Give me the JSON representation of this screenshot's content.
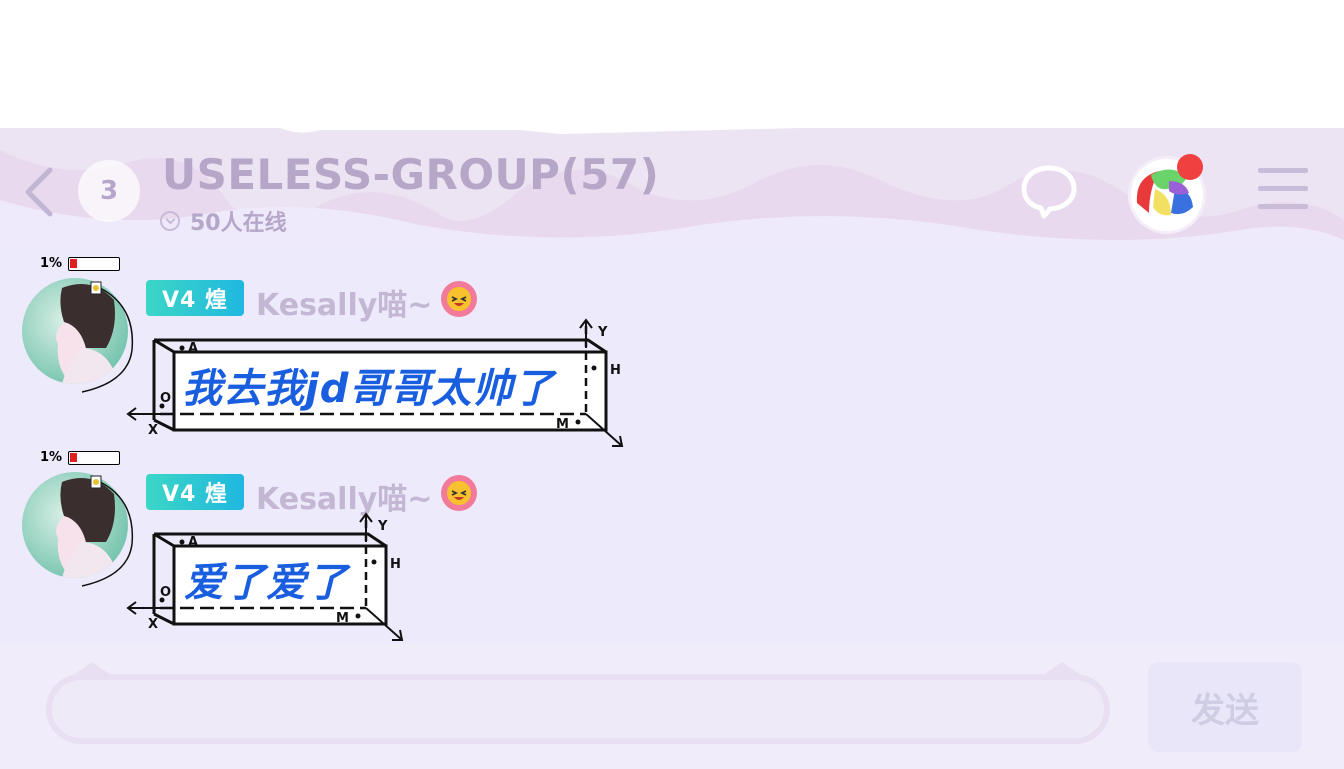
{
  "header": {
    "unread_count": "3",
    "group_title": "USELESS-GROUP(57)",
    "online_text": "50人在线",
    "icons": {
      "back": "chevron-left-icon",
      "online": "chevron-down-circle-icon",
      "chat": "speech-bubble-icon",
      "menu": "hamburger-menu-icon"
    }
  },
  "messages": [
    {
      "battery_pct": "1%",
      "level_badge": "V4 煌",
      "nickname": "Kesally喵~",
      "text": "我去我jd哥哥太帅了",
      "axis_labels": [
        "A",
        "O",
        "X",
        "Y",
        "H",
        "M"
      ]
    },
    {
      "battery_pct": "1%",
      "level_badge": "V4 煌",
      "nickname": "Kesally喵~",
      "text": "爱了爱了",
      "axis_labels": [
        "A",
        "O",
        "X",
        "Y",
        "H",
        "M"
      ]
    }
  ],
  "input": {
    "value": "",
    "placeholder": "",
    "send_label": "发送"
  },
  "colors": {
    "title": "#b6a7c9",
    "chat_bg": "#edeafb",
    "bubble_text": "#1a5ee0",
    "level_badge": "#20b8e0",
    "notification_dot": "#f04040"
  }
}
